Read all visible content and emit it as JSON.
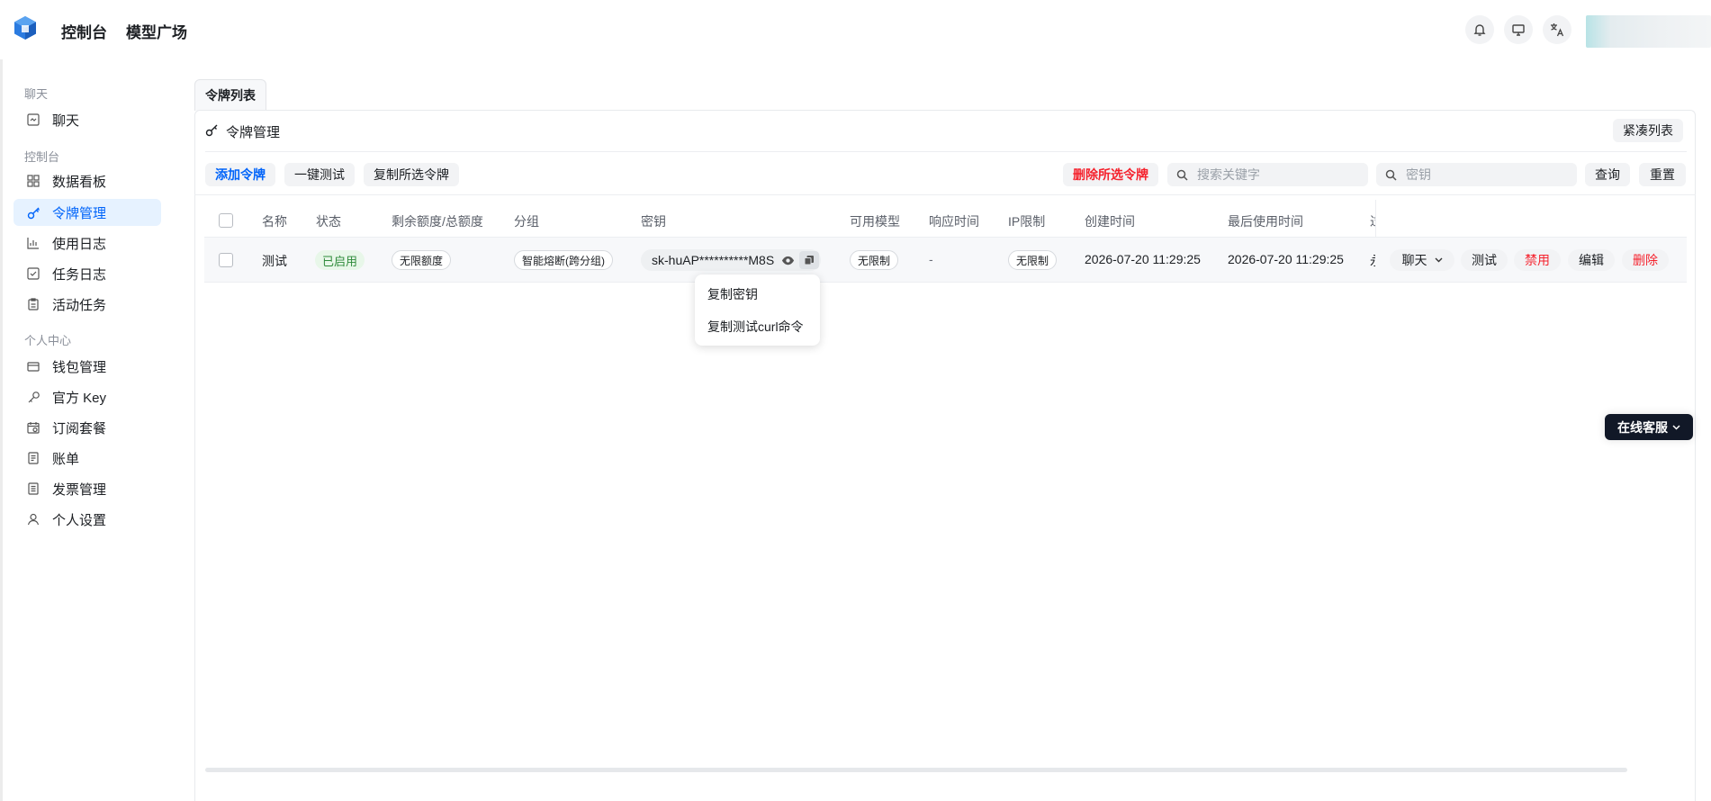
{
  "header": {
    "nav": [
      "控制台",
      "模型广场"
    ],
    "icons": [
      "bell-icon",
      "monitor-icon",
      "translate-icon"
    ]
  },
  "sidebar": {
    "sections": [
      {
        "title": "聊天",
        "items": [
          {
            "label": "聊天",
            "icon": "chat-icon"
          }
        ]
      },
      {
        "title": "控制台",
        "items": [
          {
            "label": "数据看板",
            "icon": "dashboard-icon"
          },
          {
            "label": "令牌管理",
            "icon": "key-icon",
            "active": true
          },
          {
            "label": "使用日志",
            "icon": "chart-icon"
          },
          {
            "label": "任务日志",
            "icon": "task-icon"
          },
          {
            "label": "活动任务",
            "icon": "clipboard-icon"
          }
        ]
      },
      {
        "title": "个人中心",
        "items": [
          {
            "label": "钱包管理",
            "icon": "wallet-icon"
          },
          {
            "label": "官方 Key",
            "icon": "key-alt-icon"
          },
          {
            "label": "订阅套餐",
            "icon": "calendar-icon"
          },
          {
            "label": "账单",
            "icon": "bill-icon"
          },
          {
            "label": "发票管理",
            "icon": "invoice-icon"
          },
          {
            "label": "个人设置",
            "icon": "user-icon"
          }
        ]
      }
    ]
  },
  "tab": {
    "label": "令牌列表"
  },
  "panel": {
    "title": "令牌管理",
    "compact_button": "紧凑列表"
  },
  "toolbar": {
    "add": "添加令牌",
    "test_all": "一键测试",
    "copy_selected": "复制所选令牌",
    "delete_selected": "删除所选令牌",
    "search_placeholder": "搜索关键字",
    "key_placeholder": "密钥",
    "query": "查询",
    "reset": "重置"
  },
  "table": {
    "headers": [
      "名称",
      "状态",
      "剩余额度/总额度",
      "分组",
      "密钥",
      "可用模型",
      "响应时间",
      "IP限制",
      "创建时间",
      "最后使用时间",
      "过"
    ],
    "row": {
      "name": "测试",
      "status": "已启用",
      "quota": "无限额度",
      "group": "智能熔断(跨分组)",
      "key": "sk-huAP**********M8S",
      "models": "无限制",
      "response": "-",
      "ip": "无限制",
      "created": "2026-07-20 11:29:25",
      "last_used": "2026-07-20 11:29:25",
      "expire_partial": "永",
      "actions": {
        "chat": "聊天",
        "test": "测试",
        "disable": "禁用",
        "edit": "编辑",
        "delete": "删除"
      }
    }
  },
  "dropdown": {
    "items": [
      "复制密钥",
      "复制测试curl命令"
    ]
  },
  "support": {
    "label": "在线客服"
  },
  "colors": {
    "primary": "#0064fa",
    "danger": "#f5222d",
    "success_bg": "#e8f7e9",
    "success_text": "#2e8b3a"
  }
}
